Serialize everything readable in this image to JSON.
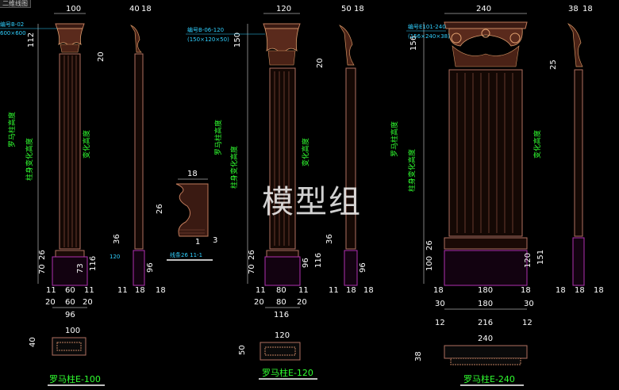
{
  "window": {
    "tab": "二维线图"
  },
  "watermark": "模型组",
  "colors": {
    "background": "#000000",
    "dimension": "#ffffff",
    "label": "#30ff30",
    "leader": "#30d0ff",
    "column": "#b07060",
    "base": "#b030b0"
  },
  "columns": [
    {
      "title": "罗马柱E-100",
      "width": "100",
      "side": "40",
      "side2": "18",
      "capital": "112",
      "tick": "20",
      "body_label": "罗马柱高度",
      "body_label2": "柱身变化高度",
      "side_label": "变化高度",
      "base_top": "26",
      "base_mid": "70",
      "base_right": "73",
      "base_side": "116",
      "side_dims": [
        "36",
        "96"
      ],
      "bottom_top": [
        "11",
        "60",
        "11"
      ],
      "bottom_mid": [
        "20",
        "60",
        "20"
      ],
      "bottom_total": "96",
      "side_bottom": [
        "11",
        "18",
        "18"
      ],
      "plan_width": "100",
      "plan_left": [
        "40",
        "18"
      ],
      "callout": [
        "编号B-02",
        "600×600"
      ],
      "side_callout": "120"
    },
    {
      "title": "罗马柱E-120",
      "width": "120",
      "side": "50",
      "side2": "18",
      "capital": "150",
      "tick": "20",
      "body_label": "罗马柱高度",
      "body_label2": "柱身变化高度",
      "side_label": "变化高度",
      "base_top": "26",
      "base_mid": "70",
      "base_right": "96",
      "base_side": "116",
      "side_dims": [
        "36",
        "96"
      ],
      "bottom_top": [
        "11",
        "80",
        "11"
      ],
      "bottom_mid": [
        "20",
        "80",
        "20"
      ],
      "bottom_total": "116",
      "side_bottom": [
        "11",
        "18",
        "18"
      ],
      "plan_width": "120",
      "plan_left": [
        "50",
        "18"
      ],
      "callout": [
        "编号B-06-120",
        "(150×120×50)"
      ]
    },
    {
      "title": "罗马柱E-240",
      "width": "240",
      "side": "38",
      "side2": "18",
      "capital": "156",
      "tick": "25",
      "body_label": "罗马柱高度",
      "body_label2": "柱身变化高度",
      "side_label": "变化高度",
      "base_top": "26",
      "base_mid": "100",
      "base_right": "120",
      "base_side": "151",
      "bottom_top": [
        "18",
        "180",
        "18"
      ],
      "bottom_mid": [
        "30",
        "180",
        "30"
      ],
      "bottom_total": "216",
      "bottom_side": [
        "12",
        "12"
      ],
      "side_bottom": [
        "18",
        "18",
        "18"
      ],
      "plan_width": "240",
      "plan_left": [
        "38",
        "18"
      ],
      "callout": [
        "编号E101-240",
        "(156×240×38)"
      ]
    }
  ],
  "profile": {
    "top": "18",
    "left": "26",
    "bottom": [
      "1",
      "3"
    ],
    "label": "线条26 11-1"
  }
}
